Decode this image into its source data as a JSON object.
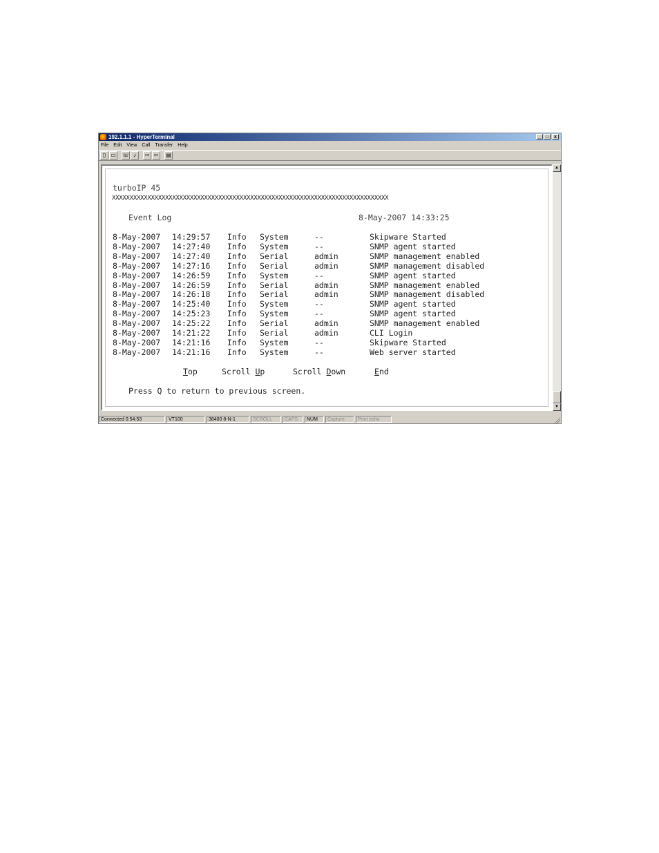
{
  "window": {
    "title": "192.1.1.1 - HyperTerminal",
    "controls": {
      "minimize": "_",
      "maximize": "□",
      "close": "x"
    }
  },
  "menu": [
    "File",
    "Edit",
    "View",
    "Call",
    "Transfer",
    "Help"
  ],
  "terminal": {
    "product": "turboIP 45",
    "separator": "XXXXXXXXXXXXXXXXXXXXXXXXXXXXXXXXXXXXXXXXXXXXXXXXXXXXXXXXXXXXXXXXXXXXXXXXXXXXXX",
    "section_title": "Event Log",
    "datetime": "8-May-2007 14:33:25",
    "events": [
      {
        "date": "8-May-2007",
        "time": "14:29:57",
        "level": "Info",
        "source": "System",
        "user": "--",
        "message": "Skipware Started"
      },
      {
        "date": "8-May-2007",
        "time": "14:27:40",
        "level": "Info",
        "source": "System",
        "user": "--",
        "message": "SNMP agent started"
      },
      {
        "date": "8-May-2007",
        "time": "14:27:40",
        "level": "Info",
        "source": "Serial",
        "user": "admin",
        "message": "SNMP management enabled"
      },
      {
        "date": "8-May-2007",
        "time": "14:27:16",
        "level": "Info",
        "source": "Serial",
        "user": "admin",
        "message": "SNMP management disabled"
      },
      {
        "date": "8-May-2007",
        "time": "14:26:59",
        "level": "Info",
        "source": "System",
        "user": "--",
        "message": "SNMP agent started"
      },
      {
        "date": "8-May-2007",
        "time": "14:26:59",
        "level": "Info",
        "source": "Serial",
        "user": "admin",
        "message": "SNMP management enabled"
      },
      {
        "date": "8-May-2007",
        "time": "14:26:18",
        "level": "Info",
        "source": "Serial",
        "user": "admin",
        "message": "SNMP management disabled"
      },
      {
        "date": "8-May-2007",
        "time": "14:25:40",
        "level": "Info",
        "source": "System",
        "user": "--",
        "message": "SNMP agent started"
      },
      {
        "date": "8-May-2007",
        "time": "14:25:23",
        "level": "Info",
        "source": "System",
        "user": "--",
        "message": "SNMP agent started"
      },
      {
        "date": "8-May-2007",
        "time": "14:25:22",
        "level": "Info",
        "source": "Serial",
        "user": "admin",
        "message": "SNMP management enabled"
      },
      {
        "date": "8-May-2007",
        "time": "14:21:22",
        "level": "Info",
        "source": "Serial",
        "user": "admin",
        "message": "CLI Login"
      },
      {
        "date": "8-May-2007",
        "time": "14:21:16",
        "level": "Info",
        "source": "System",
        "user": "--",
        "message": "Skipware Started"
      },
      {
        "date": "8-May-2007",
        "time": "14:21:16",
        "level": "Info",
        "source": "System",
        "user": "--",
        "message": "Web server started"
      }
    ],
    "nav": [
      {
        "pre": "",
        "key": "T",
        "post": "op"
      },
      {
        "pre": "Scroll ",
        "key": "U",
        "post": "p"
      },
      {
        "pre": "Scroll ",
        "key": "D",
        "post": "own"
      },
      {
        "pre": "",
        "key": "E",
        "post": "nd"
      }
    ],
    "prompt": {
      "pre": "Press ",
      "key": "Q",
      "post": " to return to previous screen."
    }
  },
  "status": [
    {
      "text": "Connected 0:54:53",
      "active": true
    },
    {
      "text": "VT100",
      "active": true
    },
    {
      "text": "38400 8-N-1",
      "active": true
    },
    {
      "text": "SCROLL",
      "active": false
    },
    {
      "text": "CAPS",
      "active": false
    },
    {
      "text": "NUM",
      "active": true
    },
    {
      "text": "Capture",
      "active": false
    },
    {
      "text": "Print echo",
      "active": false
    }
  ]
}
